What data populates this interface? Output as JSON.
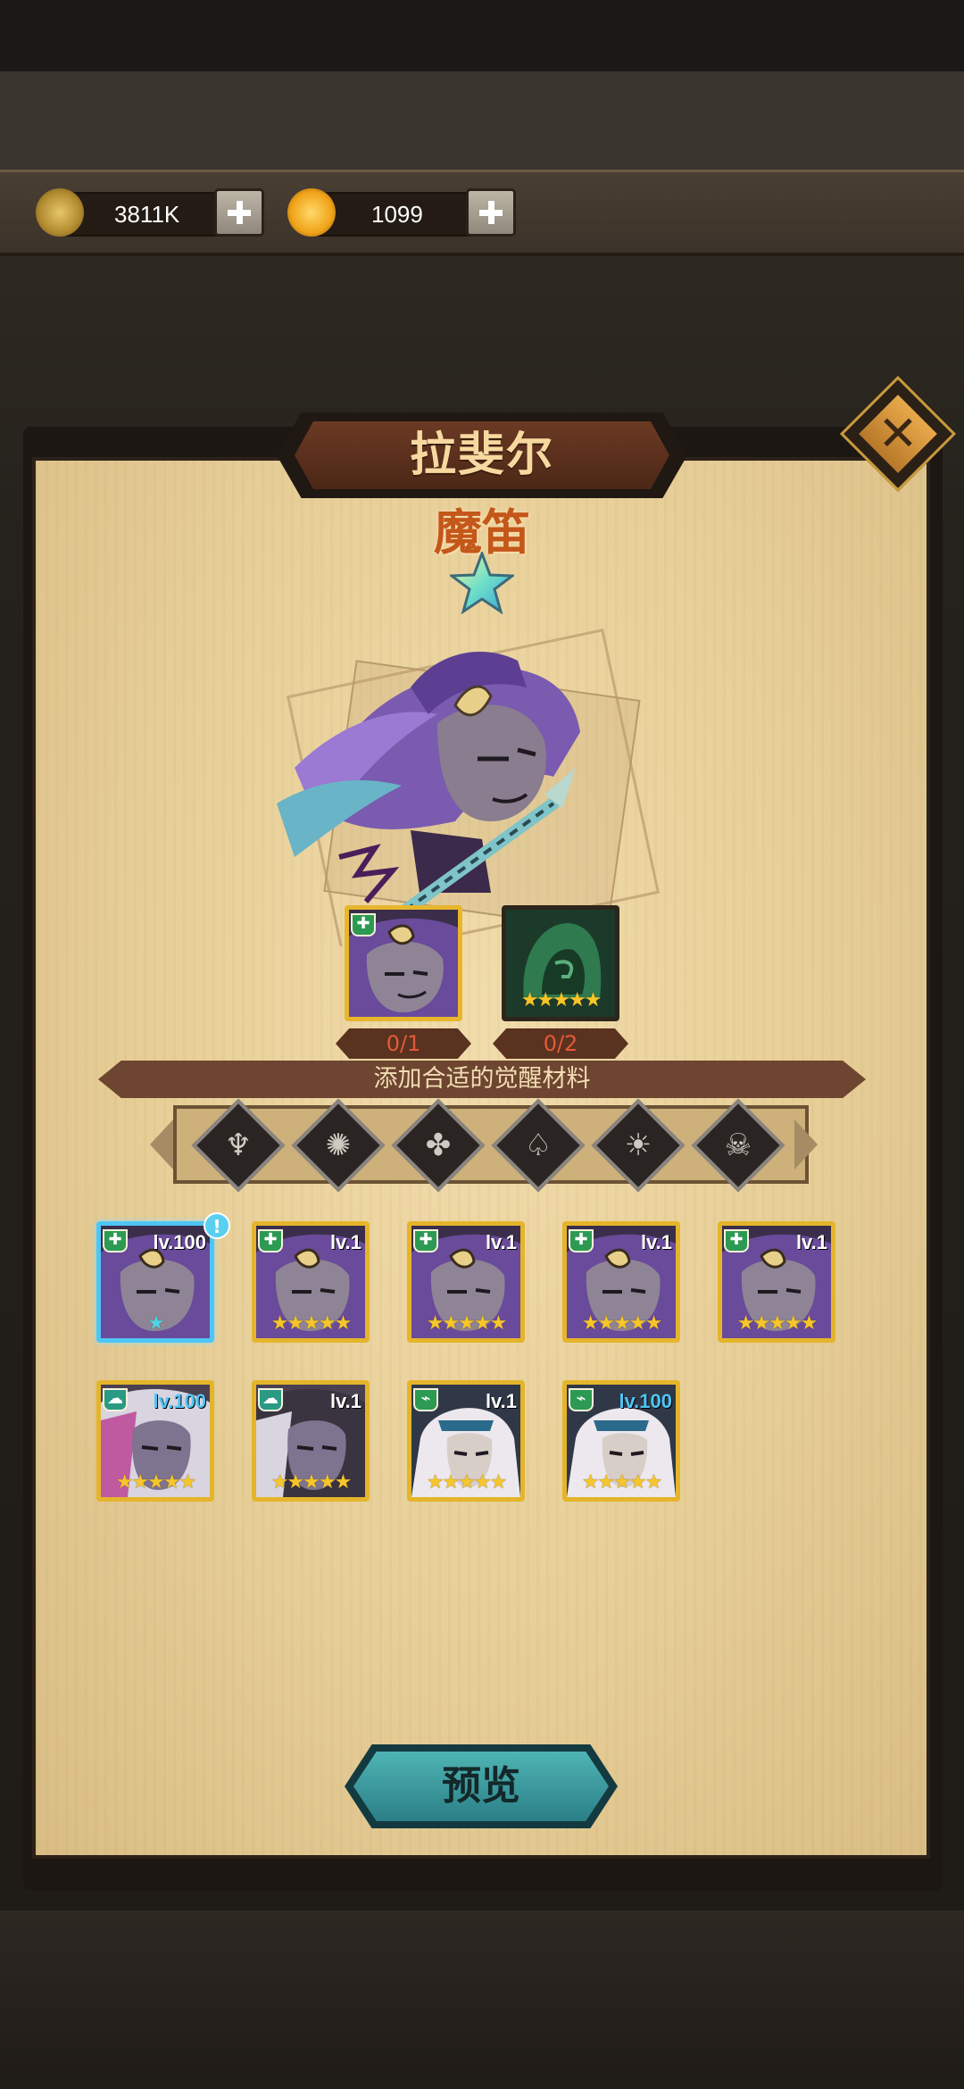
{
  "resources": {
    "gold": "3811K",
    "gems": "1099"
  },
  "hero": {
    "name": "拉斐尔",
    "class": "魔笛"
  },
  "materials": [
    {
      "count": "0/1"
    },
    {
      "count": "0/2"
    }
  ],
  "hint": "添加合适的觉醒材料",
  "filters": [
    "faction-1-icon",
    "faction-2-icon",
    "faction-3-icon",
    "faction-4-icon",
    "faction-5-icon",
    "faction-6-icon"
  ],
  "cards": [
    {
      "level": "lv.100",
      "stars": "★",
      "selected": true
    },
    {
      "level": "lv.1",
      "stars": "★★★★★"
    },
    {
      "level": "lv.1",
      "stars": "★★★★★"
    },
    {
      "level": "lv.1",
      "stars": "★★★★★"
    },
    {
      "level": "lv.1",
      "stars": "★★★★★"
    },
    {
      "level": "lv.100",
      "stars": "★★★★★"
    },
    {
      "level": "lv.1",
      "stars": "★★★★★"
    },
    {
      "level": "lv.1",
      "stars": "★★★★★"
    },
    {
      "level": "lv.100",
      "stars": "★★★★★"
    }
  ],
  "preview_label": "预览",
  "material_stars": "★★★★★",
  "notify_mark": "!",
  "close_mark": "✕"
}
